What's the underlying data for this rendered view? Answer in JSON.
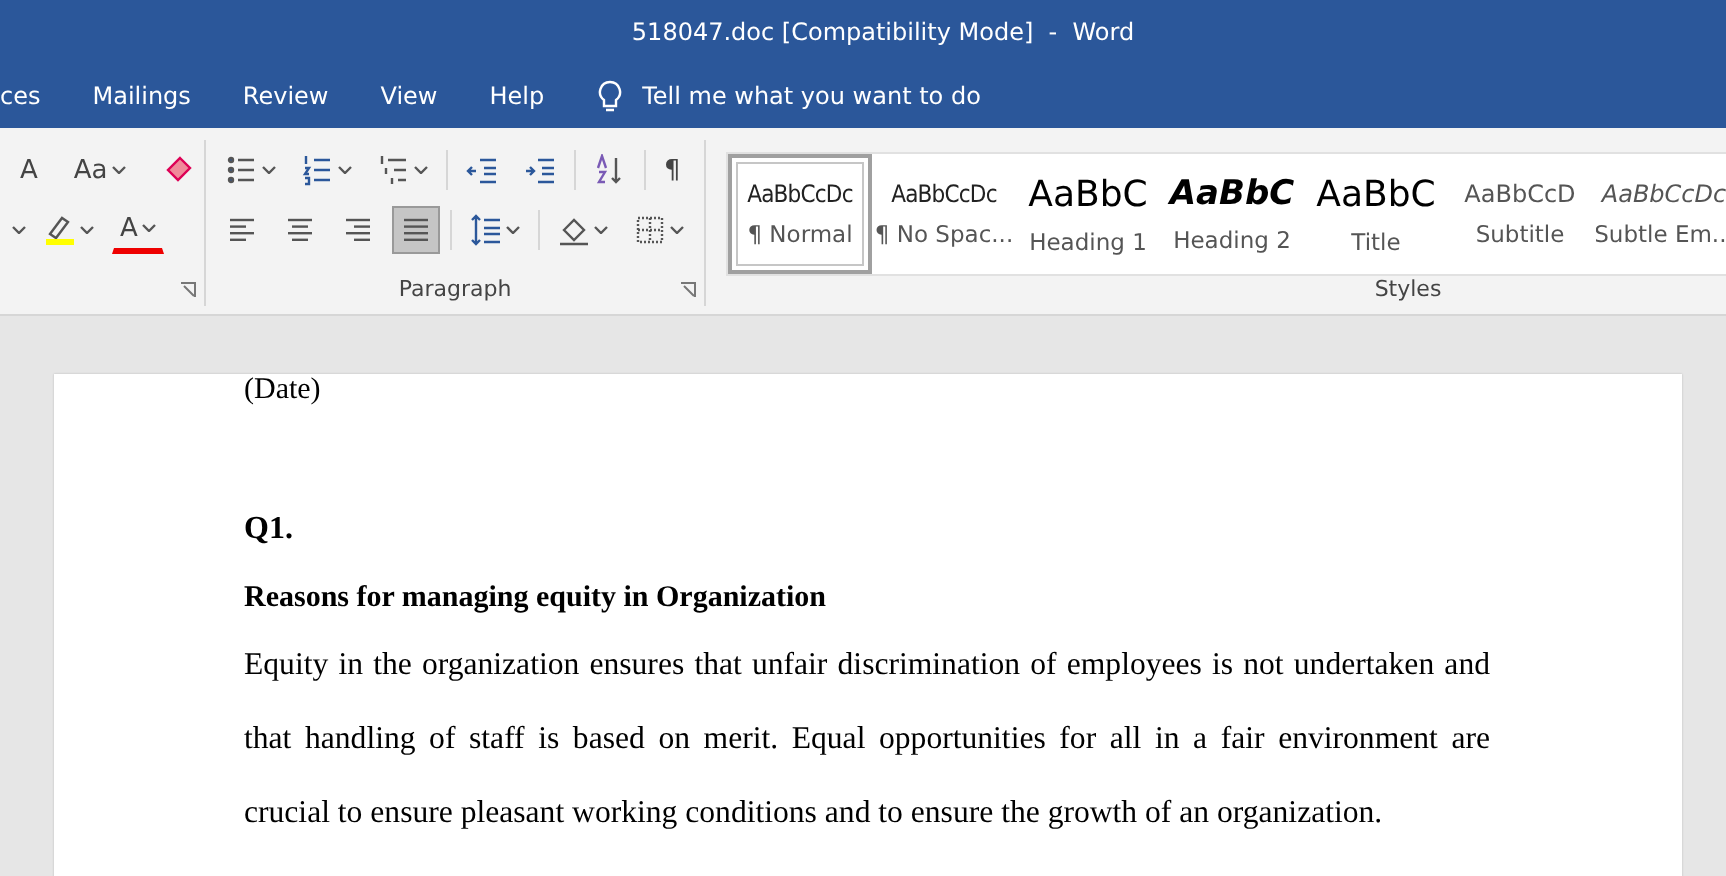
{
  "window": {
    "title": "518047.doc [Compatibility Mode]  -  Word"
  },
  "menu_tabs": [
    {
      "label": "ces",
      "selected": false
    },
    {
      "label": "Mailings",
      "selected": false
    },
    {
      "label": "Review",
      "selected": false
    },
    {
      "label": "View",
      "selected": false
    },
    {
      "label": "Help",
      "selected": false
    }
  ],
  "tell_me": {
    "placeholder": "Tell me what you want to do"
  },
  "font_group": {
    "grow_font": "A",
    "change_case": "Aa",
    "font_color": "A"
  },
  "paragraph_group": {
    "label": "Paragraph",
    "show_marks": "¶",
    "justify_selected": true
  },
  "styles_group": {
    "label": "Styles",
    "items": [
      {
        "kind": "normal",
        "preview": "AaBbCcDc",
        "name": "¶ Normal",
        "selected": true
      },
      {
        "kind": "normal",
        "preview": "AaBbCcDc",
        "name": "¶ No Spac...",
        "selected": false
      },
      {
        "kind": "heading1",
        "preview": "AaBbC",
        "name": "Heading 1",
        "selected": false
      },
      {
        "kind": "heading2",
        "preview": "AaBbC",
        "name": "Heading 2",
        "selected": false
      },
      {
        "kind": "title",
        "preview": "AaBbC",
        "name": "Title",
        "selected": false
      },
      {
        "kind": "subtitle",
        "preview": "AaBbCcD",
        "name": "Subtitle",
        "selected": false
      },
      {
        "kind": "emphasis",
        "preview": "AaBbCcDc",
        "name": "Subtle Em...",
        "selected": false
      }
    ]
  },
  "document": {
    "blocks": [
      {
        "kind": "plain",
        "text": "(Date)"
      },
      {
        "kind": "heading",
        "text": "Q1."
      },
      {
        "kind": "subheading",
        "text": "Reasons for managing equity in Organization"
      },
      {
        "kind": "body",
        "text": "Equity in the organization ensures that unfair discrimination of employees is not undertaken and that handling of staff is based on merit. Equal opportunities for all in a fair environment are crucial to ensure pleasant working conditions and to ensure the growth of an organization."
      }
    ]
  }
}
